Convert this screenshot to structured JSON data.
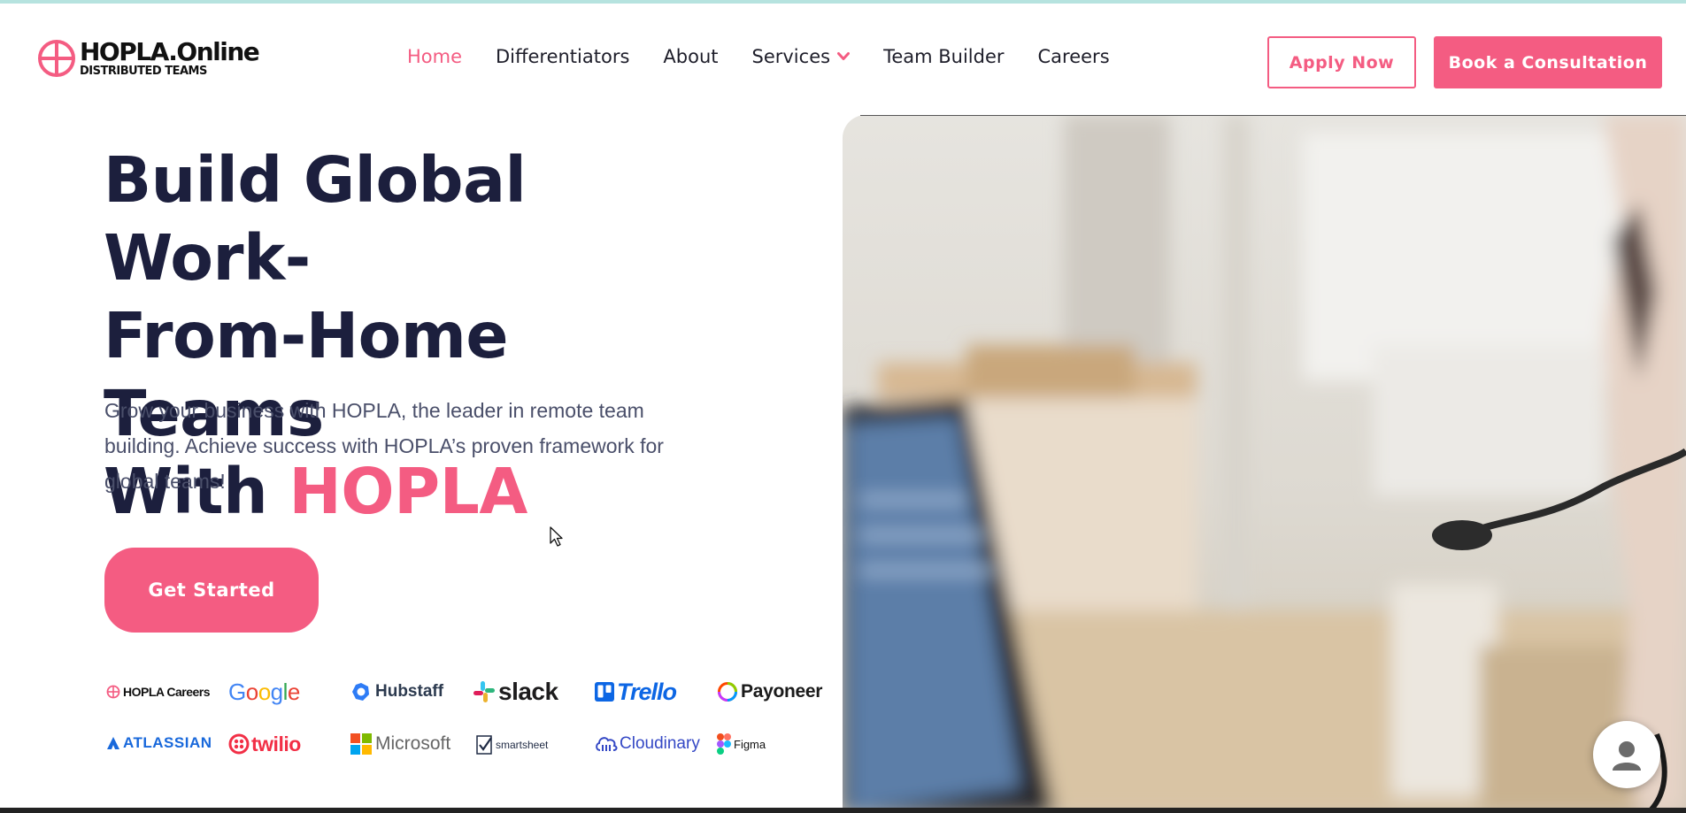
{
  "brand": {
    "name": "HOPLA.Online",
    "tagline": "DISTRIBUTED TEAMS",
    "accent_color": "#f45c82",
    "heading_color": "#1c1f3d"
  },
  "nav": {
    "items": [
      {
        "label": "Home",
        "active": true
      },
      {
        "label": "Differentiators",
        "active": false
      },
      {
        "label": "About",
        "active": false
      },
      {
        "label": "Services",
        "active": false,
        "has_dropdown": true
      },
      {
        "label": "Team Builder",
        "active": false
      },
      {
        "label": "Careers",
        "active": false
      }
    ]
  },
  "header_actions": {
    "apply_label": "Apply Now",
    "consult_label": "Book a Consultation"
  },
  "hero": {
    "title_line1": "Build Global Work-",
    "title_line2": "From-Home Teams",
    "title_line3_prefix": "With ",
    "title_line3_accent": "HOPLA",
    "description_line1": "Grow your business with HOPLA, the leader in remote team",
    "description_line2": "building. Achieve success with HOPLA’s proven framework for",
    "description_line3": "global teams!",
    "cta_label": "Get Started"
  },
  "partner_logos": [
    {
      "name": "HOPLA Careers",
      "icon": "globe-icon"
    },
    {
      "name": "Google",
      "icon": "google-wordmark"
    },
    {
      "name": "Hubstaff",
      "icon": "hubstaff-icon"
    },
    {
      "name": "slack",
      "icon": "slack-icon"
    },
    {
      "name": "Trello",
      "icon": "trello-icon"
    },
    {
      "name": "Payoneer",
      "icon": "payoneer-icon"
    },
    {
      "name": "ATLASSIAN",
      "icon": "atlassian-icon"
    },
    {
      "name": "twilio",
      "icon": "twilio-icon"
    },
    {
      "name": "Microsoft",
      "icon": "microsoft-icon"
    },
    {
      "name": "smartsheet",
      "icon": "smartsheet-icon"
    },
    {
      "name": "Cloudinary",
      "icon": "cloudinary-icon"
    },
    {
      "name": "Figma",
      "icon": "figma-icon"
    }
  ],
  "widgets": {
    "chat_icon": "user-avatar-icon"
  }
}
